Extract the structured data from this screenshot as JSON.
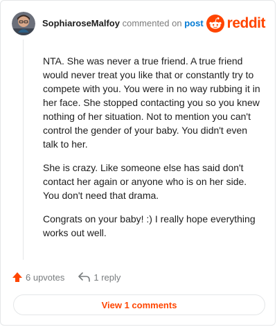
{
  "header": {
    "username": "SophiaroseMalfoy",
    "action": "commented on",
    "target": "post",
    "brand": "reddit"
  },
  "comment": {
    "paragraphs": [
      "NTA. She was never a true friend. A true friend would never treat you like that or constantly try to compete with you. You were in no way rubbing it in her face. She stopped contacting you so you knew nothing of her situation. Not to mention you can't control the gender of your baby. You didn't even talk to her.",
      "She is crazy. Like someone else has said don't contact her again or anyone who is on her side. You don't need that drama.",
      "Congrats on your baby! :) I really hope everything works out well."
    ]
  },
  "footer": {
    "upvotes": "6 upvotes",
    "replies": "1 reply"
  },
  "view_comments_label": "View 1 comments",
  "colors": {
    "brand": "#ff4500",
    "link": "#0079d3"
  }
}
